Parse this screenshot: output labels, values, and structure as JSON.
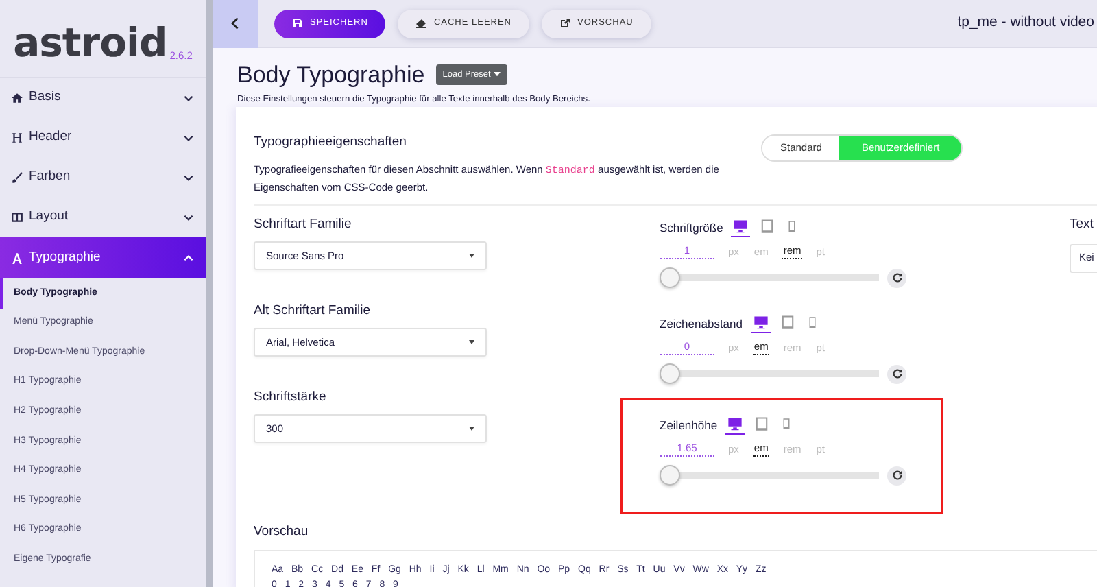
{
  "sidebar": {
    "logo": "astroid",
    "version": "2.6.2",
    "items": [
      {
        "label": "Basis",
        "expanded": false,
        "selected": false
      },
      {
        "label": "Header",
        "expanded": false,
        "selected": false
      },
      {
        "label": "Farben",
        "expanded": false,
        "selected": false
      },
      {
        "label": "Layout",
        "expanded": false,
        "selected": false
      },
      {
        "label": "Typographie",
        "expanded": true,
        "selected": true,
        "children": [
          {
            "label": "Body Typographie",
            "selected": true
          },
          {
            "label": "Menü Typographie",
            "selected": false
          },
          {
            "label": "Drop-Down-Menü Typographie",
            "selected": false
          },
          {
            "label": "H1 Typographie",
            "selected": false
          },
          {
            "label": "H2 Typographie",
            "selected": false
          },
          {
            "label": "H3 Typographie",
            "selected": false
          },
          {
            "label": "H4 Typographie",
            "selected": false
          },
          {
            "label": "H5 Typographie",
            "selected": false
          },
          {
            "label": "H6 Typographie",
            "selected": false
          },
          {
            "label": "Eigene Typografie",
            "selected": false
          }
        ]
      }
    ]
  },
  "toolbar": {
    "buttons": [
      {
        "label": "SPEICHERN",
        "kind": "primary"
      },
      {
        "label": "CACHE LEEREN",
        "kind": "light"
      },
      {
        "label": "VORSCHAU",
        "kind": "light"
      }
    ],
    "site_title": "tp_me - without video"
  },
  "page": {
    "title": "Body Typographie",
    "preset_button": "Load Preset",
    "description": "Diese Einstellungen steuern die Typographie für alle Texte innerhalb des Body Bereichs."
  },
  "section": {
    "title": "Typographieeigenschaften",
    "description": [
      {
        "kind": "text",
        "text": "Typografieeigenschaften für diesen Abschnitt auswählen. Wenn "
      },
      {
        "kind": "code",
        "text": "Standard"
      },
      {
        "kind": "text",
        "text": " ausgewählt ist, werden die Eigenschaften vom CSS-Code geerbt."
      }
    ],
    "modes": [
      {
        "label": "Standard",
        "selected": false
      },
      {
        "label": "Benutzerdefiniert",
        "selected": true
      }
    ]
  },
  "selects": [
    {
      "label": "Schriftart Familie",
      "value": "Source Sans Pro"
    },
    {
      "label": "Alt Schriftart Familie",
      "value": "Arial, Helvetica"
    },
    {
      "label": "Schriftstärke",
      "value": "300"
    }
  ],
  "sliders": [
    {
      "label": "Schriftgröße",
      "value": "1",
      "highlighted": false,
      "level": 0,
      "devices": [
        {
          "kind": "desktop",
          "selected": true
        },
        {
          "kind": "tablet",
          "selected": false
        },
        {
          "kind": "phone",
          "selected": false
        }
      ],
      "units": [
        {
          "label": "px",
          "selected": false
        },
        {
          "label": "em",
          "selected": false
        },
        {
          "label": "rem",
          "selected": true
        },
        {
          "label": "pt",
          "selected": false
        }
      ]
    },
    {
      "label": "Zeichenabstand",
      "value": "0",
      "highlighted": false,
      "level": 0,
      "devices": [
        {
          "kind": "desktop",
          "selected": true
        },
        {
          "kind": "tablet",
          "selected": false
        },
        {
          "kind": "phone",
          "selected": false
        }
      ],
      "units": [
        {
          "label": "px",
          "selected": false
        },
        {
          "label": "em",
          "selected": true
        },
        {
          "label": "rem",
          "selected": false
        },
        {
          "label": "pt",
          "selected": false
        }
      ]
    },
    {
      "label": "Zeilenhöhe",
      "value": "1.65",
      "highlighted": true,
      "level": 0,
      "devices": [
        {
          "kind": "desktop",
          "selected": true
        },
        {
          "kind": "tablet",
          "selected": false
        },
        {
          "kind": "phone",
          "selected": false
        }
      ],
      "units": [
        {
          "label": "px",
          "selected": false
        },
        {
          "label": "em",
          "selected": true
        },
        {
          "label": "rem",
          "selected": false
        },
        {
          "label": "pt",
          "selected": false
        }
      ]
    }
  ],
  "right_column": {
    "label": "Text",
    "select_value": "Kei"
  },
  "preview": {
    "title": "Vorschau",
    "letters": "Aa Bb Cc Dd Ee Ff Gg Hh Ii Jj Kk Ll Mm Nn Oo Pp Qq Rr Ss Tt Uu Vv Ww Xx Yy Zz",
    "digits": "0 1 2 3 4 5 6 7 8 9"
  }
}
